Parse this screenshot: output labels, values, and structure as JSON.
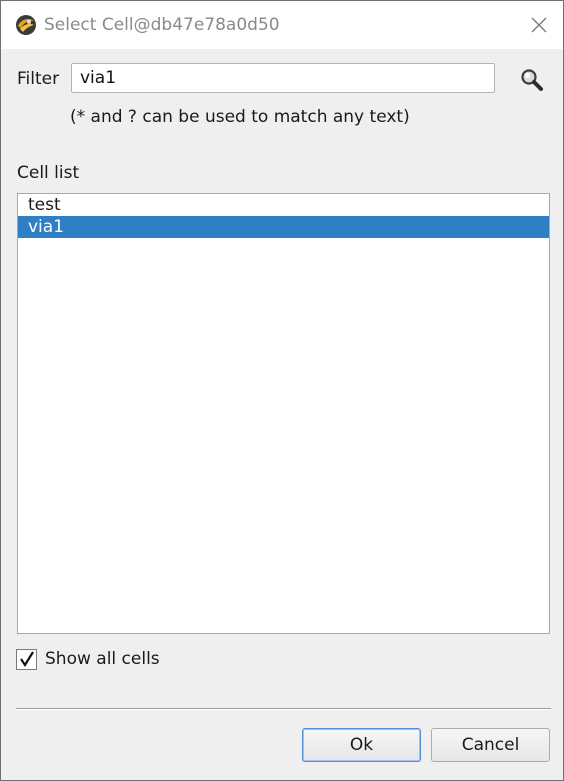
{
  "window": {
    "title": "Select Cell@db47e78a0d50"
  },
  "filter": {
    "label": "Filter",
    "value": "via1",
    "hint": "(* and ? can be used to match any text)"
  },
  "cell_list": {
    "label": "Cell list",
    "items": [
      {
        "label": "test",
        "selected": false
      },
      {
        "label": "via1",
        "selected": true
      }
    ]
  },
  "show_all_cells": {
    "label": "Show all cells",
    "checked": true
  },
  "buttons": {
    "ok_label": "Ok",
    "cancel_label": "Cancel"
  },
  "colors": {
    "selection": "#2f7fc4",
    "default_button_border": "#4f8fd6"
  },
  "icons": {
    "app": "klayout-logo-icon",
    "close": "close-icon",
    "search": "magnifier-icon",
    "checkbox": "checkmark-icon"
  }
}
